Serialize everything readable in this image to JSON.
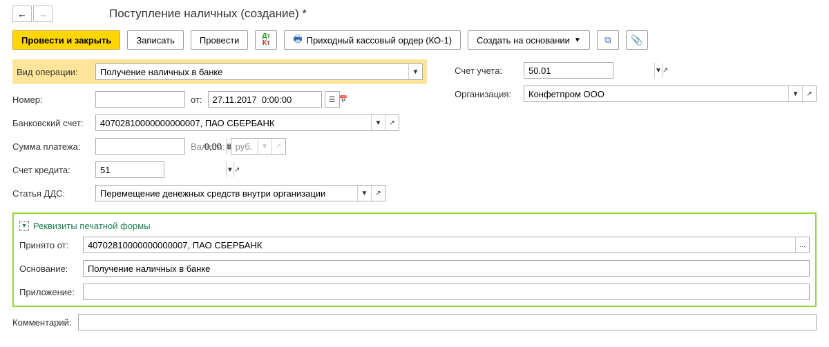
{
  "title": "Поступление наличных (создание) *",
  "toolbar": {
    "post_close": "Провести и закрыть",
    "save": "Записать",
    "post": "Провести",
    "print_order": "Приходный кассовый ордер (КО-1)",
    "create_based": "Создать на основании"
  },
  "labels": {
    "operation_type": "Вид операции:",
    "number": "Номер:",
    "from": "от:",
    "bank_account": "Банковский счет:",
    "payment_sum": "Сумма платежа:",
    "currency": "Валюта:",
    "credit_account": "Счет кредита:",
    "dds": "Статья ДДС:",
    "account": "Счет учета:",
    "organization": "Организация:",
    "comment": "Комментарий:",
    "accepted_from": "Принято от:",
    "basis": "Основание:",
    "attachment": "Приложение:"
  },
  "values": {
    "operation_type": "Получение наличных в банке",
    "number": "",
    "date": "27.11.2017  0:00:00",
    "bank_account": "40702810000000000007, ПАО СБЕРБАНК",
    "payment_sum": "0,00",
    "currency": "руб.",
    "credit_account": "51",
    "dds": "Перемещение денежных средств внутри организации",
    "account": "50.01",
    "organization": "Конфетпром ООО",
    "accepted_from": "40702810000000000007, ПАО СБЕРБАНК",
    "basis": "Получение наличных в банке",
    "attachment": "",
    "comment": ""
  },
  "section": {
    "print_form": "Реквизиты печатной формы"
  }
}
